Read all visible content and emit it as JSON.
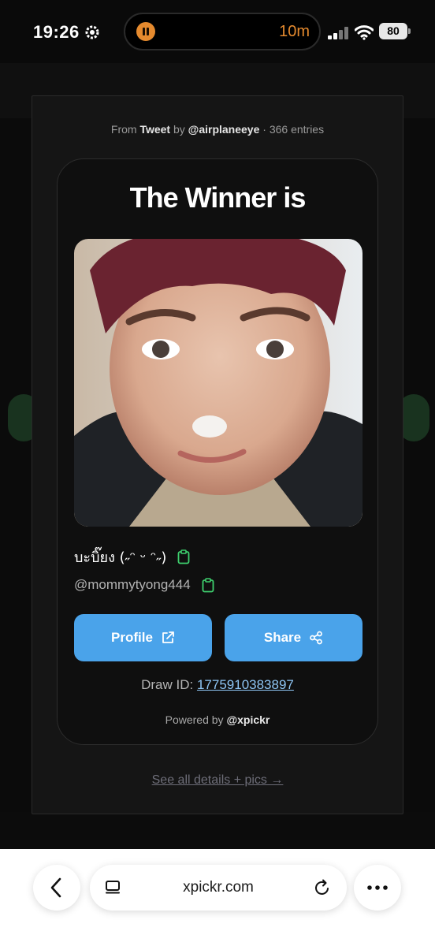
{
  "status_bar": {
    "time": "19:26",
    "activity_timer": "10m",
    "battery": "80"
  },
  "modal": {
    "source_prefix": "From",
    "source_type": "Tweet",
    "source_by": "by",
    "source_account": "@airplaneeye",
    "source_entries": "· 366 entries",
    "details_link": "See all details + pics →"
  },
  "winner_card": {
    "title": "The Winner is",
    "display_name": "บะบิ๊ยง (˶ᵔ ᵕ ᵔ˶)",
    "username": "@mommytyong444",
    "profile_button": "Profile",
    "share_button": "Share",
    "draw_id_label": "Draw ID:",
    "draw_id_value": "1775910383897",
    "powered_prefix": "Powered by",
    "powered_brand": "@xpickr"
  },
  "browser": {
    "url": "xpickr.com"
  },
  "colors": {
    "accent_blue": "#4aa3ea",
    "clipboard_green": "#3ecf6e",
    "timer_orange": "#e58a2e"
  },
  "icons": [
    "gear-icon",
    "pause-icon",
    "signal-icon",
    "wifi-icon",
    "battery-icon",
    "clipboard-icon",
    "external-link-icon",
    "share-icon",
    "back-chevron-icon",
    "tabs-icon",
    "reload-icon",
    "more-icon"
  ]
}
